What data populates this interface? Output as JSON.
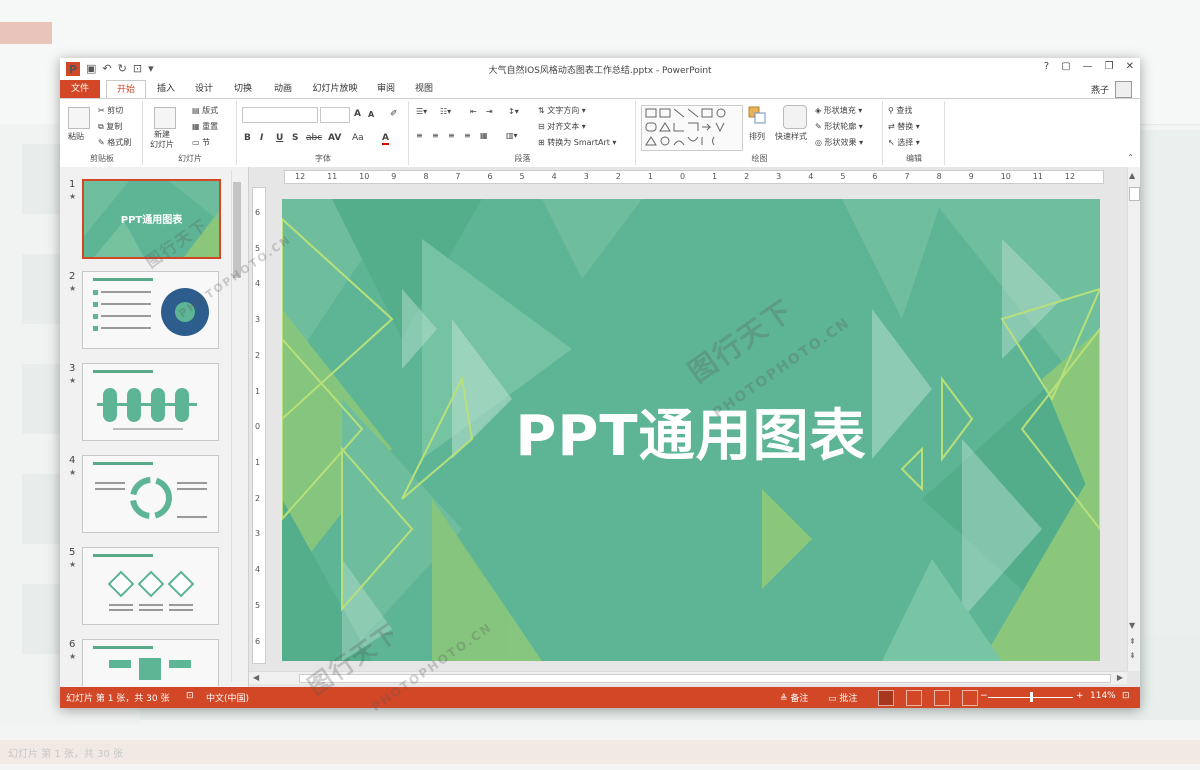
{
  "app": {
    "window_title": "大气自然IOS风格动态图表工作总结.pptx - PowerPoint",
    "user_name": "燕子",
    "help": "?",
    "ribbon_display": "▢",
    "minimize": "—",
    "restore": "❐",
    "close": "✕"
  },
  "menu": {
    "file": "文件",
    "tabs": [
      "开始",
      "插入",
      "设计",
      "切换",
      "动画",
      "幻灯片放映",
      "审阅",
      "视图"
    ]
  },
  "ribbon": {
    "clipboard": {
      "label": "剪贴板",
      "paste": "粘贴",
      "cut": "剪切",
      "copy": "复制",
      "format_painter": "格式刷"
    },
    "slides": {
      "label": "幻灯片",
      "new_slide_line1": "新建",
      "new_slide_line2": "幻灯片",
      "layout": "版式",
      "reset": "重置",
      "section": "节"
    },
    "font": {
      "label": "字体",
      "bold": "B",
      "italic": "I",
      "underline": "U",
      "shadow": "S",
      "strike": "abc",
      "spacing": "AV",
      "case": "Aa",
      "color": "A",
      "grow": "A",
      "shrink": "A"
    },
    "paragraph": {
      "label": "段落",
      "text_direction": "文字方向",
      "align_text": "对齐文本",
      "smartart": "转换为 SmartArt"
    },
    "drawing": {
      "label": "绘图",
      "arrange": "排列",
      "quick_styles": "快速样式",
      "shape_fill": "形状填充",
      "shape_outline": "形状轮廓",
      "shape_effects": "形状效果"
    },
    "editing": {
      "label": "编辑",
      "find": "查找",
      "replace": "替换",
      "select": "选择"
    }
  },
  "thumbnails": [
    {
      "num": "1",
      "title": "PPT通用图表"
    },
    {
      "num": "2"
    },
    {
      "num": "3"
    },
    {
      "num": "4"
    },
    {
      "num": "5"
    },
    {
      "num": "6"
    }
  ],
  "ruler": {
    "h_labels": [
      "12",
      "11",
      "10",
      "9",
      "8",
      "7",
      "6",
      "5",
      "4",
      "3",
      "2",
      "1",
      "0",
      "1",
      "2",
      "3",
      "4",
      "5",
      "6",
      "7",
      "8",
      "9",
      "10",
      "11",
      "12"
    ],
    "v_labels": [
      "6",
      "5",
      "4",
      "3",
      "2",
      "1",
      "0",
      "1",
      "2",
      "3",
      "4",
      "5",
      "6"
    ]
  },
  "slide": {
    "title": "PPT通用图表",
    "background": "#5db595"
  },
  "status": {
    "slide_info": "幻灯片 第 1 张，共 30 张",
    "language": "中文(中国)",
    "notes": "备注",
    "comments": "批注",
    "zoom": "114%",
    "zoom_minus": "−",
    "zoom_plus": "+"
  },
  "watermark": {
    "brand": "图行天下",
    "url": "PHOTOPHOTO.CN"
  },
  "colors": {
    "accent": "#d24726",
    "slide_green": "#5db595",
    "lime": "#a9d36b"
  }
}
